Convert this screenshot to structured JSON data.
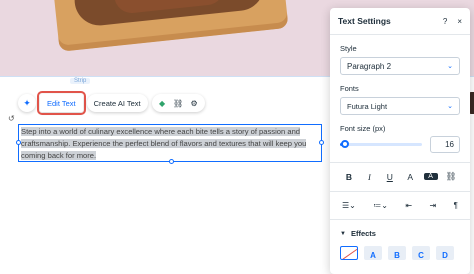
{
  "canvas": {
    "strip_tag": "Strip",
    "toolbar": {
      "ai_icon": "sparkle-icon",
      "edit_text_label": "Edit Text",
      "create_ai_text_label": "Create AI Text",
      "icons": [
        "animation-icon",
        "link-icon",
        "settings-icon"
      ]
    },
    "text_box": {
      "content": "Step into a world of culinary excellence where each bite tells a story of passion and craftsmanship. Experience the perfect blend of flavors and textures that will keep you coming back for more."
    }
  },
  "panel": {
    "title": "Text Settings",
    "help_icon": "?",
    "close_icon": "×",
    "style": {
      "label": "Style",
      "value": "Paragraph 2"
    },
    "fonts": {
      "label": "Fonts",
      "value": "Futura Light"
    },
    "font_size": {
      "label": "Font size (px)",
      "value": "16",
      "slider_fraction": 0.05
    },
    "format_buttons": [
      "B",
      "I",
      "U",
      "A",
      "A",
      "⛓"
    ],
    "effects": {
      "label": "Effects",
      "options": [
        "",
        "A",
        "B",
        "C",
        "D"
      ]
    }
  },
  "colors": {
    "accent": "#116dff",
    "highlight": "#e1544a",
    "text": "#20303c"
  }
}
